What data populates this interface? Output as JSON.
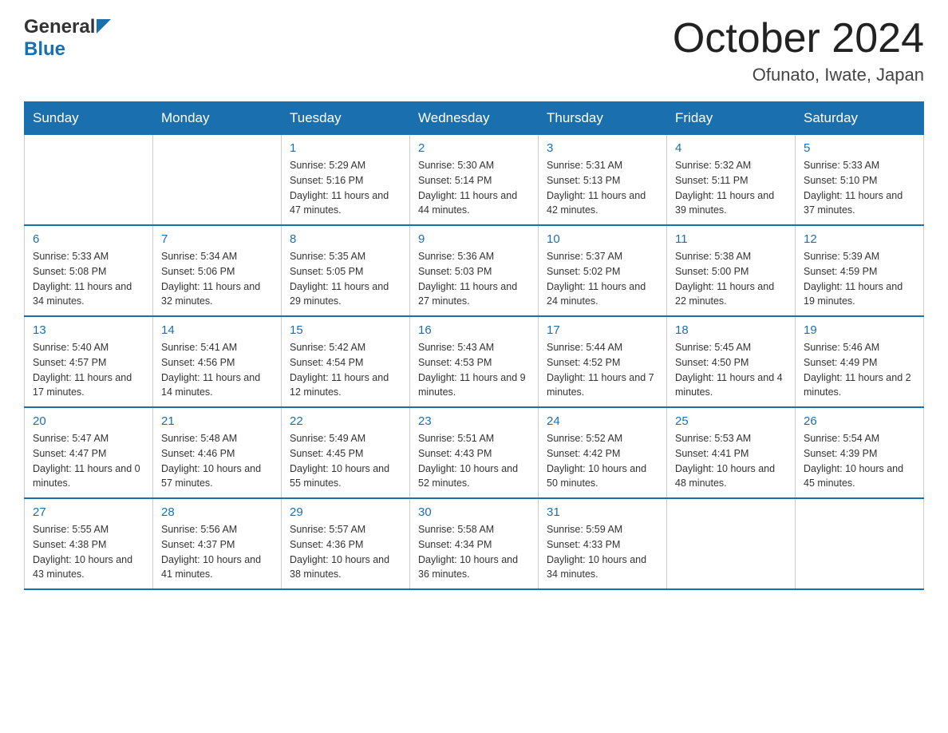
{
  "header": {
    "logo_general": "General",
    "logo_blue": "Blue",
    "month_title": "October 2024",
    "location": "Ofunato, Iwate, Japan"
  },
  "days_of_week": [
    "Sunday",
    "Monday",
    "Tuesday",
    "Wednesday",
    "Thursday",
    "Friday",
    "Saturday"
  ],
  "weeks": [
    [
      {
        "day": "",
        "sunrise": "",
        "sunset": "",
        "daylight": ""
      },
      {
        "day": "",
        "sunrise": "",
        "sunset": "",
        "daylight": ""
      },
      {
        "day": "1",
        "sunrise": "Sunrise: 5:29 AM",
        "sunset": "Sunset: 5:16 PM",
        "daylight": "Daylight: 11 hours and 47 minutes."
      },
      {
        "day": "2",
        "sunrise": "Sunrise: 5:30 AM",
        "sunset": "Sunset: 5:14 PM",
        "daylight": "Daylight: 11 hours and 44 minutes."
      },
      {
        "day": "3",
        "sunrise": "Sunrise: 5:31 AM",
        "sunset": "Sunset: 5:13 PM",
        "daylight": "Daylight: 11 hours and 42 minutes."
      },
      {
        "day": "4",
        "sunrise": "Sunrise: 5:32 AM",
        "sunset": "Sunset: 5:11 PM",
        "daylight": "Daylight: 11 hours and 39 minutes."
      },
      {
        "day": "5",
        "sunrise": "Sunrise: 5:33 AM",
        "sunset": "Sunset: 5:10 PM",
        "daylight": "Daylight: 11 hours and 37 minutes."
      }
    ],
    [
      {
        "day": "6",
        "sunrise": "Sunrise: 5:33 AM",
        "sunset": "Sunset: 5:08 PM",
        "daylight": "Daylight: 11 hours and 34 minutes."
      },
      {
        "day": "7",
        "sunrise": "Sunrise: 5:34 AM",
        "sunset": "Sunset: 5:06 PM",
        "daylight": "Daylight: 11 hours and 32 minutes."
      },
      {
        "day": "8",
        "sunrise": "Sunrise: 5:35 AM",
        "sunset": "Sunset: 5:05 PM",
        "daylight": "Daylight: 11 hours and 29 minutes."
      },
      {
        "day": "9",
        "sunrise": "Sunrise: 5:36 AM",
        "sunset": "Sunset: 5:03 PM",
        "daylight": "Daylight: 11 hours and 27 minutes."
      },
      {
        "day": "10",
        "sunrise": "Sunrise: 5:37 AM",
        "sunset": "Sunset: 5:02 PM",
        "daylight": "Daylight: 11 hours and 24 minutes."
      },
      {
        "day": "11",
        "sunrise": "Sunrise: 5:38 AM",
        "sunset": "Sunset: 5:00 PM",
        "daylight": "Daylight: 11 hours and 22 minutes."
      },
      {
        "day": "12",
        "sunrise": "Sunrise: 5:39 AM",
        "sunset": "Sunset: 4:59 PM",
        "daylight": "Daylight: 11 hours and 19 minutes."
      }
    ],
    [
      {
        "day": "13",
        "sunrise": "Sunrise: 5:40 AM",
        "sunset": "Sunset: 4:57 PM",
        "daylight": "Daylight: 11 hours and 17 minutes."
      },
      {
        "day": "14",
        "sunrise": "Sunrise: 5:41 AM",
        "sunset": "Sunset: 4:56 PM",
        "daylight": "Daylight: 11 hours and 14 minutes."
      },
      {
        "day": "15",
        "sunrise": "Sunrise: 5:42 AM",
        "sunset": "Sunset: 4:54 PM",
        "daylight": "Daylight: 11 hours and 12 minutes."
      },
      {
        "day": "16",
        "sunrise": "Sunrise: 5:43 AM",
        "sunset": "Sunset: 4:53 PM",
        "daylight": "Daylight: 11 hours and 9 minutes."
      },
      {
        "day": "17",
        "sunrise": "Sunrise: 5:44 AM",
        "sunset": "Sunset: 4:52 PM",
        "daylight": "Daylight: 11 hours and 7 minutes."
      },
      {
        "day": "18",
        "sunrise": "Sunrise: 5:45 AM",
        "sunset": "Sunset: 4:50 PM",
        "daylight": "Daylight: 11 hours and 4 minutes."
      },
      {
        "day": "19",
        "sunrise": "Sunrise: 5:46 AM",
        "sunset": "Sunset: 4:49 PM",
        "daylight": "Daylight: 11 hours and 2 minutes."
      }
    ],
    [
      {
        "day": "20",
        "sunrise": "Sunrise: 5:47 AM",
        "sunset": "Sunset: 4:47 PM",
        "daylight": "Daylight: 11 hours and 0 minutes."
      },
      {
        "day": "21",
        "sunrise": "Sunrise: 5:48 AM",
        "sunset": "Sunset: 4:46 PM",
        "daylight": "Daylight: 10 hours and 57 minutes."
      },
      {
        "day": "22",
        "sunrise": "Sunrise: 5:49 AM",
        "sunset": "Sunset: 4:45 PM",
        "daylight": "Daylight: 10 hours and 55 minutes."
      },
      {
        "day": "23",
        "sunrise": "Sunrise: 5:51 AM",
        "sunset": "Sunset: 4:43 PM",
        "daylight": "Daylight: 10 hours and 52 minutes."
      },
      {
        "day": "24",
        "sunrise": "Sunrise: 5:52 AM",
        "sunset": "Sunset: 4:42 PM",
        "daylight": "Daylight: 10 hours and 50 minutes."
      },
      {
        "day": "25",
        "sunrise": "Sunrise: 5:53 AM",
        "sunset": "Sunset: 4:41 PM",
        "daylight": "Daylight: 10 hours and 48 minutes."
      },
      {
        "day": "26",
        "sunrise": "Sunrise: 5:54 AM",
        "sunset": "Sunset: 4:39 PM",
        "daylight": "Daylight: 10 hours and 45 minutes."
      }
    ],
    [
      {
        "day": "27",
        "sunrise": "Sunrise: 5:55 AM",
        "sunset": "Sunset: 4:38 PM",
        "daylight": "Daylight: 10 hours and 43 minutes."
      },
      {
        "day": "28",
        "sunrise": "Sunrise: 5:56 AM",
        "sunset": "Sunset: 4:37 PM",
        "daylight": "Daylight: 10 hours and 41 minutes."
      },
      {
        "day": "29",
        "sunrise": "Sunrise: 5:57 AM",
        "sunset": "Sunset: 4:36 PM",
        "daylight": "Daylight: 10 hours and 38 minutes."
      },
      {
        "day": "30",
        "sunrise": "Sunrise: 5:58 AM",
        "sunset": "Sunset: 4:34 PM",
        "daylight": "Daylight: 10 hours and 36 minutes."
      },
      {
        "day": "31",
        "sunrise": "Sunrise: 5:59 AM",
        "sunset": "Sunset: 4:33 PM",
        "daylight": "Daylight: 10 hours and 34 minutes."
      },
      {
        "day": "",
        "sunrise": "",
        "sunset": "",
        "daylight": ""
      },
      {
        "day": "",
        "sunrise": "",
        "sunset": "",
        "daylight": ""
      }
    ]
  ]
}
